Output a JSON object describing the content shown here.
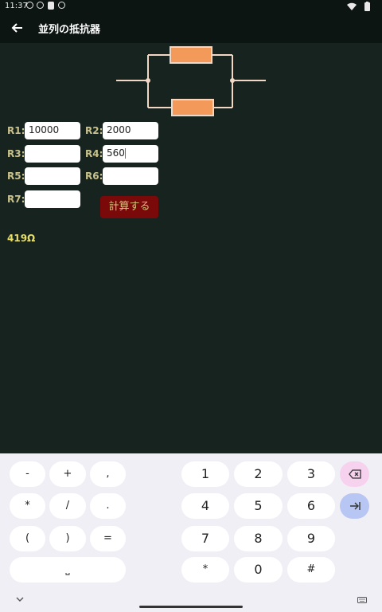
{
  "status_bar": {
    "time": "11:37"
  },
  "app_bar": {
    "title": "並列の抵抗器"
  },
  "colors": {
    "background": "#17231f",
    "resistor": "#f39a5b",
    "wire": "#f3d7c5",
    "button": "#7a0a0a",
    "result": "#e8df6a",
    "label": "#c9c28a"
  },
  "form": {
    "r1": {
      "label": "R1:",
      "value": "10000"
    },
    "r2": {
      "label": "R2:",
      "value": "2000"
    },
    "r3": {
      "label": "R3:",
      "value": ""
    },
    "r4": {
      "label": "R4:",
      "value": "560"
    },
    "r5": {
      "label": "R5:",
      "value": ""
    },
    "r6": {
      "label": "R6:",
      "value": ""
    },
    "r7": {
      "label": "R7:",
      "value": ""
    },
    "calculate_label": "計算する",
    "result": "419Ω"
  },
  "keyboard": {
    "symbols": {
      "minus": "-",
      "plus": "+",
      "comma": ",",
      "multiply": "*",
      "slash": "/",
      "period": ".",
      "open_paren": "(",
      "close_paren": ")",
      "equals": "=",
      "space": "⎵"
    },
    "digits": {
      "d1": "1",
      "d2": "2",
      "d3": "3",
      "d4": "4",
      "d5": "5",
      "d6": "6",
      "d7": "7",
      "d8": "8",
      "d9": "9",
      "star": "*",
      "d0": "0",
      "hash": "#"
    },
    "icons": {
      "backspace": "backspace-icon",
      "tab": "tab-icon"
    }
  }
}
